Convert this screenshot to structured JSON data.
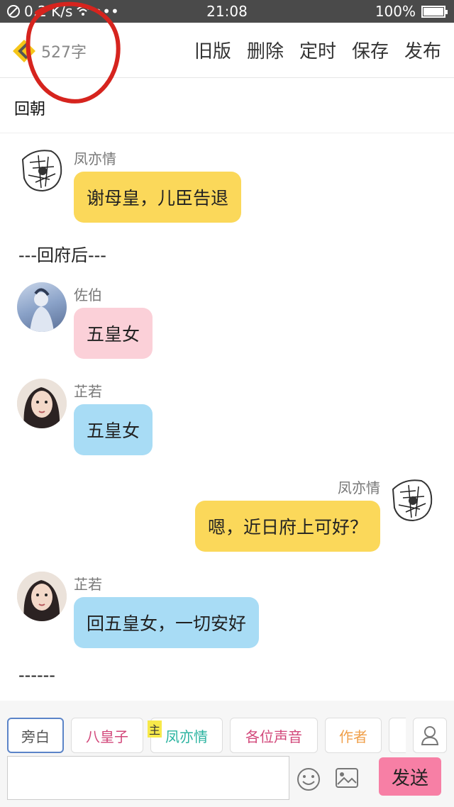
{
  "status_bar": {
    "speed": "0.2 K/s",
    "dots": "•••",
    "time": "21:08",
    "battery": "100%"
  },
  "header": {
    "word_count": "527字",
    "actions": [
      "旧版",
      "删除",
      "定时",
      "保存",
      "发布"
    ]
  },
  "story": {
    "title": "回朝"
  },
  "messages": [
    {
      "name": "凤亦情",
      "text": "谢母皇，儿臣告退",
      "color": "#fbd85a"
    },
    {
      "narration": "---回府后---"
    },
    {
      "name": "佐伯",
      "text": "五皇女",
      "color": "#fbd0d8"
    },
    {
      "name": "芷若",
      "text": "五皇女",
      "color": "#a8dcf5"
    },
    {
      "name": "凤亦情",
      "text": "嗯，近日府上可好？",
      "color": "#fbd85a"
    },
    {
      "name": "芷若",
      "text": "回五皇女，一切安好",
      "color": "#a8dcf5"
    },
    {
      "narration": "------"
    }
  ],
  "roles": [
    {
      "label": "旁白",
      "color": "#555555"
    },
    {
      "label": "八皇子",
      "color": "#d2477a"
    },
    {
      "label": "凤亦情",
      "color": "#2bb3a0"
    },
    {
      "label": "各位声音",
      "color": "#d2477a"
    },
    {
      "label": "作者",
      "color": "#f0a04b"
    }
  ],
  "main_badge": "主",
  "input": {
    "placeholder": ""
  },
  "send_label": "发送",
  "colors": {
    "status_bar": "#4a4a4a",
    "send": "#f77fa5",
    "accent_back": "#f5c518"
  },
  "icons": [
    "back-arrow-icon",
    "emoji-icon",
    "image-icon",
    "person-icon",
    "wifi-icon",
    "battery-icon"
  ]
}
